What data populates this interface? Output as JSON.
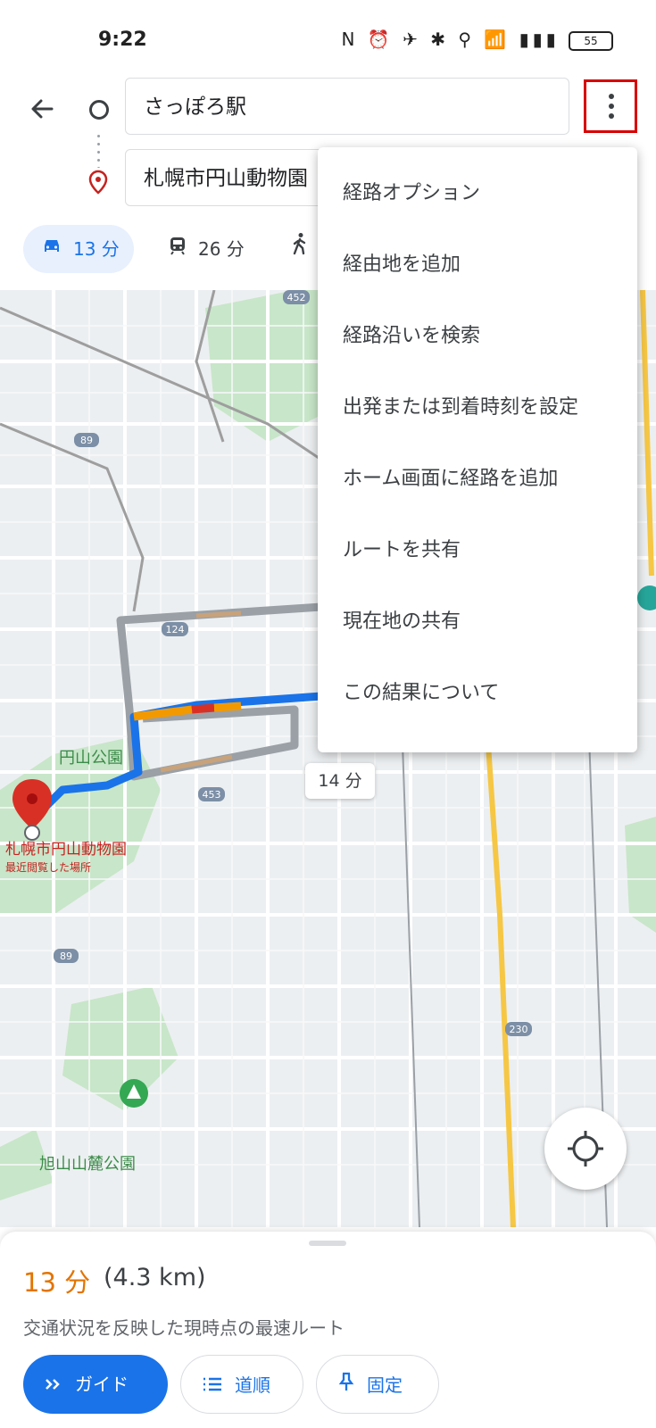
{
  "status_bar": {
    "time": "9:22",
    "icons": "N ⏰ ✈ ✱ ⚲ 📶 ▮▮▮",
    "battery": "55"
  },
  "search": {
    "origin": "さっぽろ駅",
    "destination": "札幌市円山動物園"
  },
  "modes": [
    {
      "icon": "car-icon",
      "label": "13 分",
      "active": true
    },
    {
      "icon": "train-icon",
      "label": "26 分",
      "active": false
    },
    {
      "icon": "walk-icon",
      "label": "",
      "active": false
    }
  ],
  "menu": {
    "items": [
      "経路オプション",
      "経由地を追加",
      "経路沿いを検索",
      "出発または到着時刻を設定",
      "ホーム画面に経路を追加",
      "ルートを共有",
      "現在地の共有",
      "この結果について"
    ]
  },
  "map": {
    "park_label": "円山公園",
    "dest_label": "札幌市円山動物園",
    "dest_sublabel": "最近閲覧した場所",
    "park2_label": "旭山山麓公園",
    "alt_route_time": "14 分",
    "road_numbers": [
      "452",
      "89",
      "124",
      "453",
      "89",
      "230"
    ],
    "colors": {
      "route": "#1a73e8",
      "alt_route": "#9aa0a6",
      "park": "#c8e6c9",
      "road": "#ffffff",
      "major_road": "#f6c744"
    }
  },
  "sheet": {
    "time": "13 分",
    "distance": "(4.3 km)",
    "description": "交通状況を反映した現時点の最速ルート",
    "buttons": {
      "guide": "ガイド",
      "steps": "道順",
      "pin": "固定"
    }
  }
}
